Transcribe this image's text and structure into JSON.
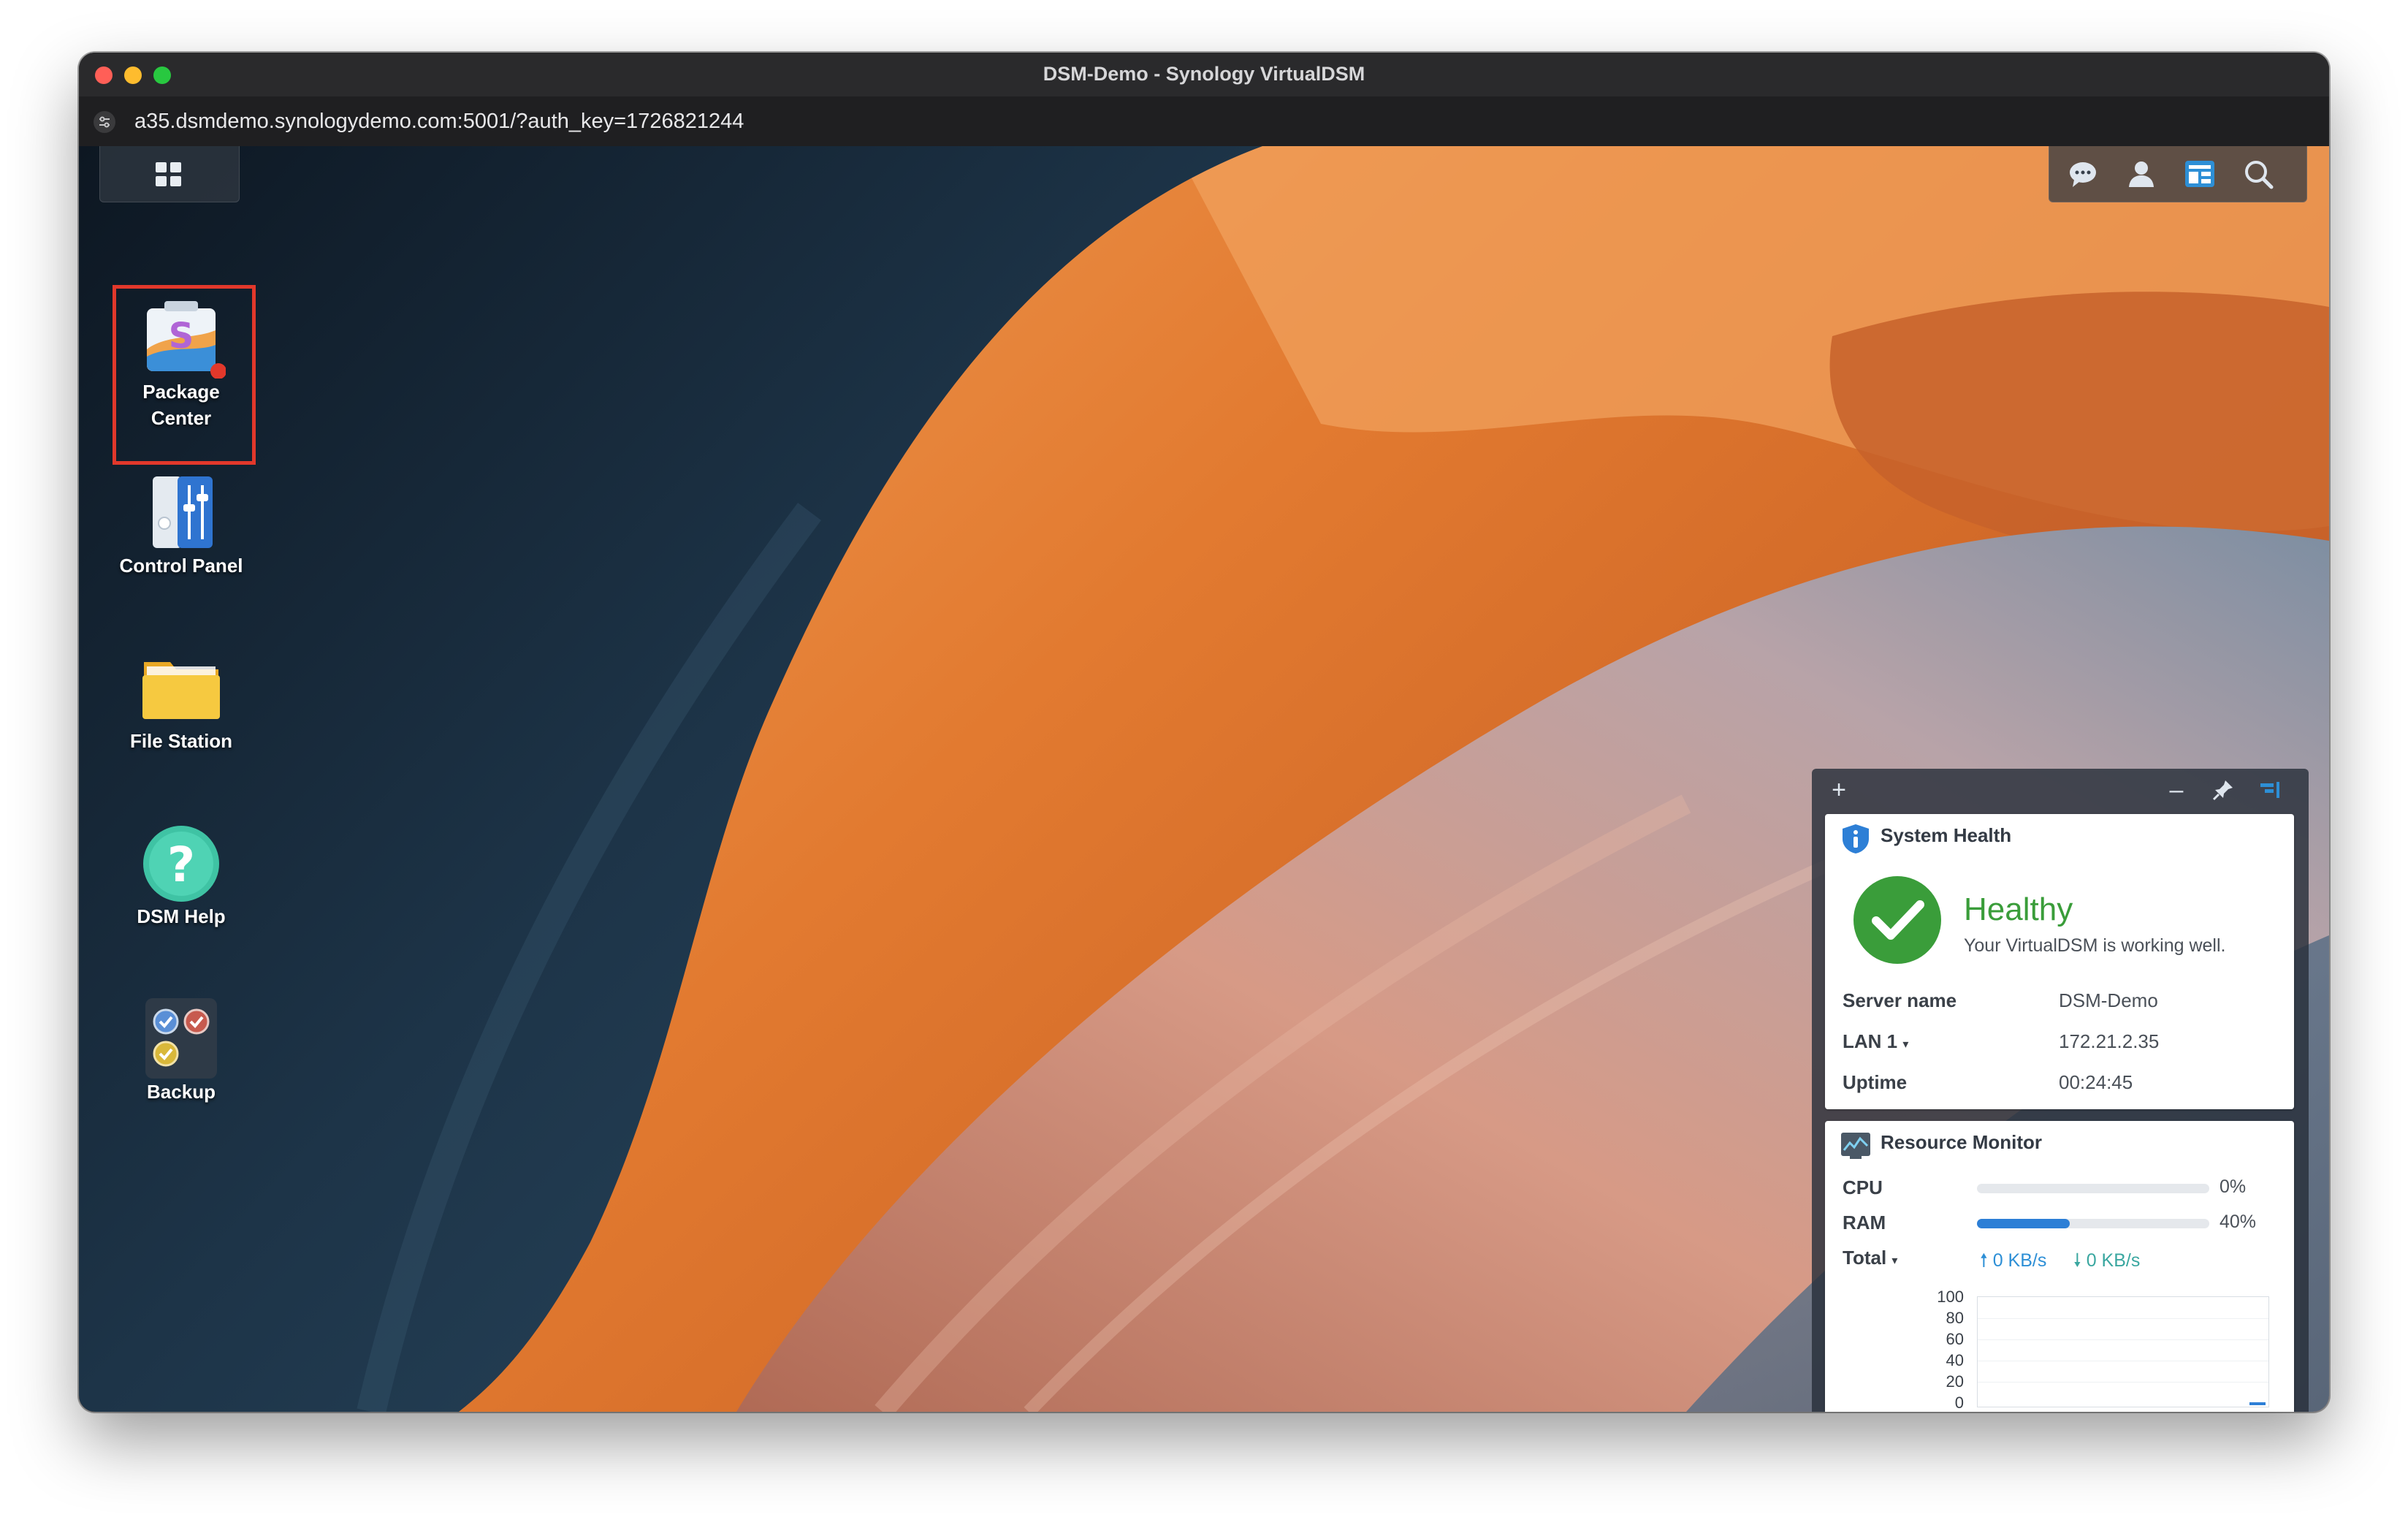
{
  "window": {
    "title": "DSM-Demo - Synology VirtualDSM",
    "url": "a35.dsmdemo.synologydemo.com:5001/?auth_key=1726821244"
  },
  "desktop_icons": [
    {
      "name": "Package Center",
      "label_line1": "Package",
      "label_line2": "Center",
      "icon": "package-center-icon",
      "selected": true
    },
    {
      "name": "Control Panel",
      "label": "Control Panel",
      "icon": "control-panel-icon"
    },
    {
      "name": "File Station",
      "label": "File Station",
      "icon": "folder-icon"
    },
    {
      "name": "DSM Help",
      "label": "DSM Help",
      "icon": "help-icon"
    },
    {
      "name": "Backup",
      "label": "Backup",
      "icon": "backup-icon"
    }
  ],
  "taskbar": {
    "icons": [
      "chat-icon",
      "user-icon",
      "widgets-icon",
      "search-icon"
    ]
  },
  "widgets": {
    "controls": [
      "add-icon",
      "minimize-icon",
      "pin-icon",
      "widget-toggle-icon"
    ],
    "system_health": {
      "title": "System Health",
      "status": "Healthy",
      "description": "Your VirtualDSM is working well.",
      "rows": [
        {
          "label": "Server name",
          "value": "DSM-Demo"
        },
        {
          "label": "LAN 1",
          "value": "172.21.2.35"
        },
        {
          "label": "Uptime",
          "value": "00:24:45"
        }
      ]
    },
    "resource_monitor": {
      "title": "Resource Monitor",
      "cpu_label": "CPU",
      "cpu_value": "0%",
      "cpu_percent": 0,
      "ram_label": "RAM",
      "ram_value": "40%",
      "ram_percent": 40,
      "net_label": "Total",
      "upload": "0 KB/s",
      "download": "0 KB/s",
      "chart_ticks": [
        "100",
        "80",
        "60",
        "40",
        "20",
        "0"
      ]
    }
  },
  "colors": {
    "accent": "#2d7fd6",
    "healthy": "#3a9d3a",
    "highlight": "#e2382b"
  }
}
